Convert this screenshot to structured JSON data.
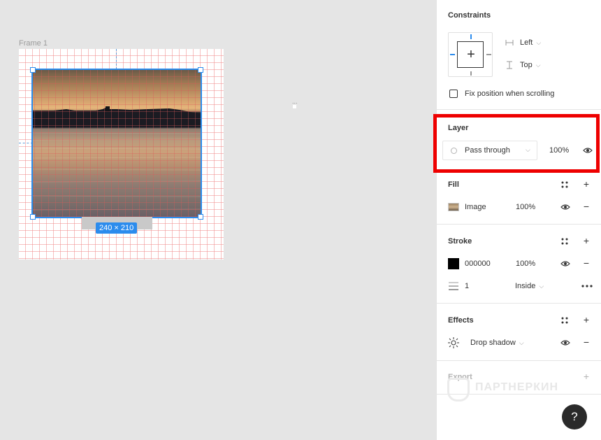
{
  "canvas": {
    "frame_label": "Frame 1",
    "size_badge": "240 × 210",
    "canvas_marker": "..."
  },
  "panel": {
    "constraints": {
      "title": "Constraints",
      "horizontal": "Left",
      "vertical": "Top",
      "fix_position_label": "Fix position when scrolling"
    },
    "layer": {
      "title": "Layer",
      "blend_mode": "Pass through",
      "opacity": "100%"
    },
    "fill": {
      "title": "Fill",
      "type": "Image",
      "opacity": "100%"
    },
    "stroke": {
      "title": "Stroke",
      "color": "000000",
      "opacity": "100%",
      "weight": "1",
      "position": "Inside"
    },
    "effects": {
      "title": "Effects",
      "effect": "Drop shadow"
    },
    "export": {
      "title": "Export"
    },
    "help_label": "?",
    "watermark": "ПАРТНЕРКИН"
  },
  "colors": {
    "selection": "#2c8ced",
    "highlight": "#ee0000",
    "stroke_swatch": "#000000"
  }
}
